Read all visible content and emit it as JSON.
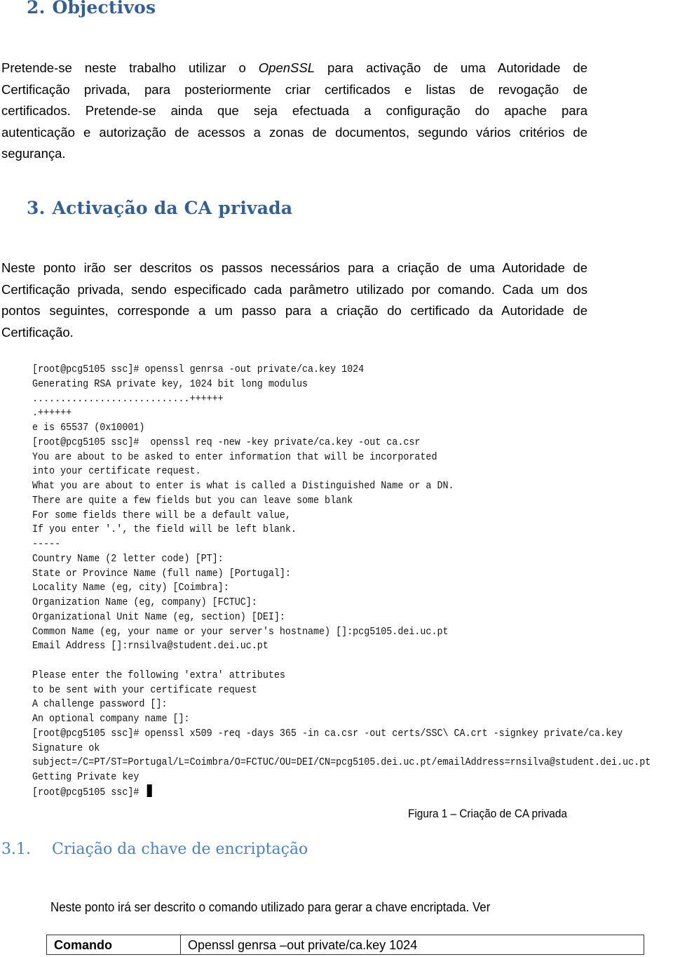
{
  "sections": {
    "objectivos": {
      "number": "2.",
      "title": "Objectivos",
      "paragraph_lines": [
        {
          "pre": "Pretende-se neste trabalho  utilizar o ",
          "em": "OpenSSL",
          "post": " para activação de uma Autoridade de"
        },
        {
          "pre": "Certificação privada, para posteriormente criar certificados e listas de revogação de",
          "em": "",
          "post": ""
        },
        {
          "pre": "certificados. Pretende-se ainda que seja efectuada a configuração do apache para",
          "em": "",
          "post": ""
        },
        {
          "pre": "autenticação e autorização de acessos a zonas de documentos, segundo vários critérios de",
          "em": "",
          "post": ""
        },
        {
          "pre": "segurança.",
          "em": "",
          "post": ""
        }
      ]
    },
    "activacao": {
      "number": "3.",
      "title": "Activação da CA privada",
      "paragraph_lines": [
        "Neste ponto irão ser descritos os passos necessários para a criação de uma Autoridade de",
        "Certificação privada, sendo especificado cada parâmetro utilizado por comando. Cada um dos",
        "pontos seguintes, corresponde a um passo para a criação do certificado da Autoridade de",
        "Certificação."
      ]
    },
    "figure": {
      "terminal_lines": [
        "[root@pcg5105 ssc]# openssl genrsa -out private/ca.key 1024",
        "Generating RSA private key, 1024 bit long modulus",
        "............................++++++",
        ".++++++",
        "e is 65537 (0x10001)",
        "[root@pcg5105 ssc]#  openssl req -new -key private/ca.key -out ca.csr",
        "You are about to be asked to enter information that will be incorporated",
        "into your certificate request.",
        "What you are about to enter is what is called a Distinguished Name or a DN.",
        "There are quite a few fields but you can leave some blank",
        "For some fields there will be a default value,",
        "If you enter '.', the field will be left blank.",
        "-----",
        "Country Name (2 letter code) [PT]:",
        "State or Province Name (full name) [Portugal]:",
        "Locality Name (eg, city) [Coimbra]:",
        "Organization Name (eg, company) [FCTUC]:",
        "Organizational Unit Name (eg, section) [DEI]:",
        "Common Name (eg, your name or your server's hostname) []:pcg5105.dei.uc.pt",
        "Email Address []:rnsilva@student.dei.uc.pt",
        "",
        "Please enter the following 'extra' attributes",
        "to be sent with your certificate request",
        "A challenge password []:",
        "An optional company name []:",
        "[root@pcg5105 ssc]# openssl x509 -req -days 365 -in ca.csr -out certs/SSC\\ CA.crt -signkey private/ca.key",
        "Signature ok",
        "subject=/C=PT/ST=Portugal/L=Coimbra/O=FCTUC/OU=DEI/CN=pcg5105.dei.uc.pt/emailAddress=rnsilva@student.dei.uc.pt",
        "Getting Private key",
        "[root@pcg5105 ssc]# "
      ],
      "caption": "Figura 1 – Criação de CA privada"
    },
    "chave": {
      "number": "3.1.",
      "title": "Criação da chave de encriptação",
      "intro": "Neste ponto irá ser descrito o comando utilizado para gerar a chave encriptada. Ver",
      "table": {
        "key": "Comando",
        "value": "Openssl genrsa –out private/ca.key 1024"
      }
    }
  },
  "colors": {
    "heading1": "#365F91",
    "heading2": "#4F81BD"
  }
}
